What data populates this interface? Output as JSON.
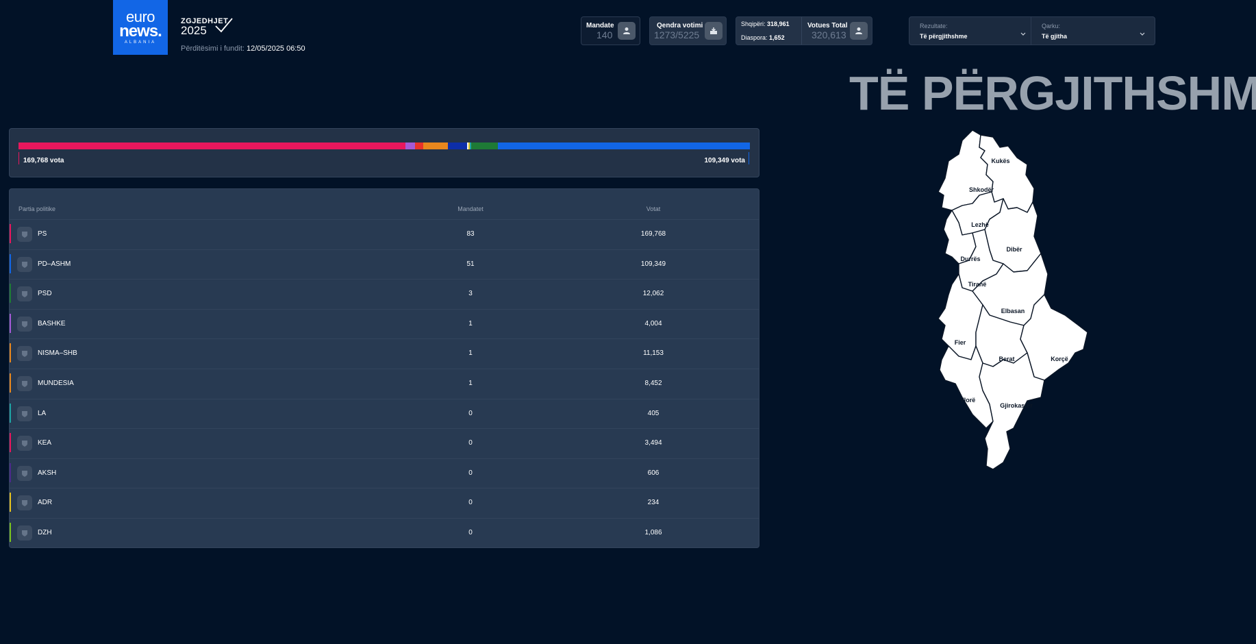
{
  "header": {
    "logo": {
      "line1": "euro",
      "line2": "news.",
      "line3": "ALBANIA"
    },
    "title_small": "ZGJEDHJET",
    "title_year": "2025",
    "updated_label": "Përditësimi i fundit:",
    "updated_value": "12/05/2025 06:50"
  },
  "stats": {
    "mandate": {
      "label": "Mandate",
      "value": "140",
      "icon": "person-icon"
    },
    "qendra": {
      "label": "Qendra votimi",
      "value": "1273/5225",
      "icon": "ballot-box-icon"
    },
    "shqiperi": {
      "label": "Shqipëri:",
      "value": "318,961"
    },
    "diaspora": {
      "label": "Diaspora:",
      "value": "1,652"
    },
    "votues": {
      "label": "Votues Total",
      "value": "320,613",
      "icon": "person-icon"
    }
  },
  "filters": {
    "rezultate": {
      "label": "Rezultate:",
      "value": "Të përgjithshme"
    },
    "qarku": {
      "label": "Qarku:",
      "value": "Të gjitha"
    }
  },
  "big_title": "TË PËRGJITHSHME",
  "bar": {
    "left_label": "169,768 vota",
    "right_label": "109,349 vota",
    "segments": [
      {
        "party": "PS",
        "color": "#e8175d",
        "share": 0.529
      },
      {
        "party": "BASHKE",
        "color": "#a45ad6",
        "share": 0.013
      },
      {
        "party": "KEA",
        "color": "#e8332a",
        "share": 0.011
      },
      {
        "party": "MUNDESIA",
        "color": "#e8871d",
        "share": 0.034
      },
      {
        "party": "PSD-alt",
        "color": "#0d2ea8",
        "share": 0.026
      },
      {
        "party": "LA",
        "color": "#f2f2f2",
        "share": 0.002
      },
      {
        "party": "ADR",
        "color": "#e6c21e",
        "share": 0.002
      },
      {
        "party": "LA2",
        "color": "#1ea3a3",
        "share": 0.002
      },
      {
        "party": "PSD",
        "color": "#1e7a36",
        "share": 0.036
      },
      {
        "party": "PD-ASHM",
        "color": "#1266e6",
        "share": 0.345
      }
    ]
  },
  "table": {
    "headers": {
      "party": "Partia politike",
      "seats": "Mandatet",
      "votes": "Votat"
    },
    "rows": [
      {
        "name": "PS",
        "seats": "83",
        "votes": "169,768",
        "color": "#e8175d",
        "icon": "ps-logo-icon"
      },
      {
        "name": "PD–ASHM",
        "seats": "51",
        "votes": "109,349",
        "color": "#1266e6",
        "icon": "pd-logo-icon"
      },
      {
        "name": "PSD",
        "seats": "3",
        "votes": "12,062",
        "color": "#1e7a36",
        "icon": "psd-rose-icon"
      },
      {
        "name": "BASHKE",
        "seats": "1",
        "votes": "4,004",
        "color": "#a45ad6",
        "icon": "bashke-logo-icon"
      },
      {
        "name": "NISMA–SHB",
        "seats": "1",
        "votes": "11,153",
        "color": "#e8871d",
        "icon": "nisma-logo-icon"
      },
      {
        "name": "MUNDESIA",
        "seats": "1",
        "votes": "8,452",
        "color": "#e8871d",
        "icon": "mundesia-logo-icon"
      },
      {
        "name": "LA",
        "seats": "0",
        "votes": "405",
        "color": "#1ea3a3",
        "icon": "shield-placeholder-icon"
      },
      {
        "name": "KEA",
        "seats": "0",
        "votes": "3,494",
        "color": "#e8175d",
        "icon": "kea-logo-icon"
      },
      {
        "name": "AKSH",
        "seats": "0",
        "votes": "606",
        "color": "#4b2a8a",
        "icon": "shield-placeholder-icon"
      },
      {
        "name": "ADR",
        "seats": "0",
        "votes": "234",
        "color": "#e6c21e",
        "icon": "shield-placeholder-icon"
      },
      {
        "name": "DZH",
        "seats": "0",
        "votes": "1,086",
        "color": "#7ac21e",
        "icon": "shield-placeholder-icon"
      }
    ]
  },
  "map": {
    "regions": [
      "Kukës",
      "Shkodër",
      "Lezhë",
      "Dibër",
      "Durrës",
      "Tiranë",
      "Elbasan",
      "Fier",
      "Berat",
      "Korçë",
      "Vlorë",
      "Gjirokastër"
    ]
  }
}
